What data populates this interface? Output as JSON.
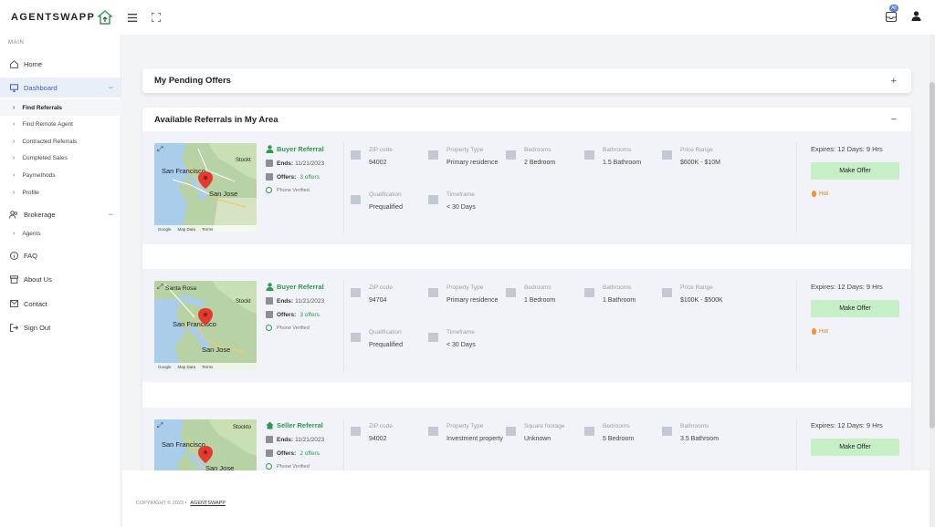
{
  "app": {
    "logo_text": "AGENTSWAPP",
    "brand_color": "#2e9a4d",
    "accent_color": "#3a5fc0"
  },
  "topbar": {
    "icons": [
      "menu-icon",
      "expand-icon",
      "inbox-icon",
      "user-icon"
    ],
    "notification_badge": "All"
  },
  "sidebar": {
    "section_label": "MAIN",
    "items": [
      {
        "label": "Home",
        "icon": "home-icon"
      },
      {
        "label": "Dashboard",
        "icon": "monitor-icon"
      },
      {
        "label": "Brokerage",
        "icon": "users-icon"
      },
      {
        "label": "FAQ",
        "icon": "info-icon"
      },
      {
        "label": "About Us",
        "icon": "archive-icon"
      },
      {
        "label": "Contact",
        "icon": "mail-icon"
      },
      {
        "label": "Sign Out",
        "icon": "signout-icon"
      }
    ],
    "dashboard_sub": [
      "Find Referrals",
      "Find Remote Agent",
      "Contracted Referrals",
      "Completed Sales",
      "Paymethods",
      "Profile"
    ],
    "brokerage_sub": [
      "Agents"
    ]
  },
  "pending": {
    "title": "My Pending Offers",
    "toggle": "+"
  },
  "available": {
    "title": "Available Referrals in My Area",
    "toggle": "−"
  },
  "cards": [
    {
      "type": "Buyer Referral",
      "ends_label": "Ends:",
      "ends": "11/21/2023",
      "offers_label": "Offers:",
      "offers": "3 offers",
      "verified": "Phone Verified",
      "map_labels": [
        "San Francisco",
        "San Jose",
        "Stockt"
      ],
      "fields": [
        {
          "label": "ZIP code",
          "value": "94002"
        },
        {
          "label": "Property Type",
          "value": "Primary residence"
        },
        {
          "label": "Bedrooms",
          "value": "2 Bedroom"
        },
        {
          "label": "Bathrooms",
          "value": "1.5 Bathroom"
        },
        {
          "label": "Price Range",
          "value": "$600K - $10M"
        },
        {
          "label": "Qualification",
          "value": "Prequalified"
        },
        {
          "label": "Timeframe",
          "value": "< 30 Days"
        }
      ],
      "expires": "Expires: 12 Days: 9 Hrs",
      "offer_button": "Make Offer",
      "hot": "Hot"
    },
    {
      "type": "Buyer Referral",
      "ends_label": "Ends:",
      "ends": "11/21/2023",
      "offers_label": "Offers:",
      "offers": "3 offers",
      "verified": "Phone Verified",
      "map_labels": [
        "Santa Rosa",
        "San Francisco",
        "San Jose",
        "Stockt"
      ],
      "fields": [
        {
          "label": "ZIP code",
          "value": "94704"
        },
        {
          "label": "Property Type",
          "value": "Primary residence"
        },
        {
          "label": "Bedrooms",
          "value": "1 Bedroom"
        },
        {
          "label": "Bathrooms",
          "value": "1 Bathroom"
        },
        {
          "label": "Price Range",
          "value": "$100K - $500K"
        },
        {
          "label": "Qualification",
          "value": "Prequalified"
        },
        {
          "label": "Timeframe",
          "value": "< 30 Days"
        }
      ],
      "expires": "Expires: 12 Days: 9 Hrs",
      "offer_button": "Make Offer",
      "hot": "Hot"
    },
    {
      "type": "Seller Referral",
      "ends_label": "Ends:",
      "ends": "11/21/2023",
      "offers_label": "Offers:",
      "offers": "2 offers",
      "verified": "Phone Verified",
      "map_labels": [
        "San Francisco",
        "San Jose",
        "Stockto"
      ],
      "fields": [
        {
          "label": "ZIP code",
          "value": "94002"
        },
        {
          "label": "Property Type",
          "value": "Investment property"
        },
        {
          "label": "Square footage",
          "value": "Unknown"
        },
        {
          "label": "Bedrooms",
          "value": "5 Bedroom"
        },
        {
          "label": "Bathrooms",
          "value": "3.5 Bathroom"
        }
      ],
      "expires": "Expires: 12 Days: 9 Hrs",
      "offer_button": "Make Offer"
    }
  ],
  "map_footer": {
    "google": "Google",
    "data": "Map Data",
    "terms": "Terms"
  },
  "footer": {
    "copyright": "COPYRIGHT © 2023 •",
    "link": "AGENTSWAPP"
  }
}
